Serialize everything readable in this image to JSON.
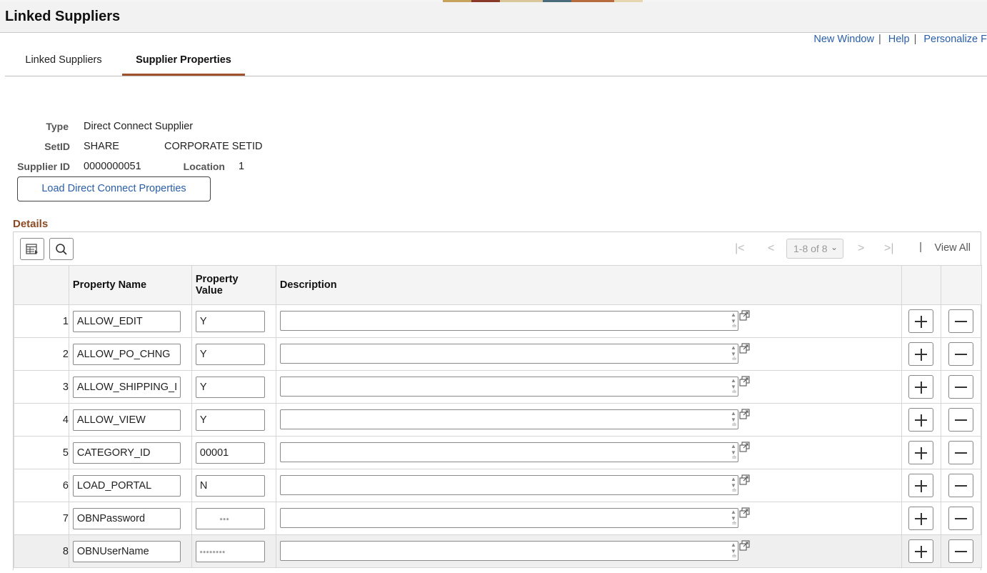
{
  "page": {
    "title": "Linked Suppliers"
  },
  "top_links": [
    {
      "label": "New Window"
    },
    {
      "label": "Help"
    },
    {
      "label": "Personalize F"
    }
  ],
  "tabs": [
    {
      "label": "Linked Suppliers",
      "active": false
    },
    {
      "label": "Supplier Properties",
      "active": true
    }
  ],
  "header": {
    "type_label": "Type",
    "type_value": "Direct Connect Supplier",
    "setid_label": "SetID",
    "setid_value": "SHARE",
    "setid_desc": "CORPORATE SETID",
    "supplier_id_label": "Supplier ID",
    "supplier_id_value": "0000000051",
    "location_label": "Location",
    "location_value": "1"
  },
  "load_button": {
    "label": "Load Direct Connect Properties"
  },
  "details": {
    "title": "Details",
    "pager": {
      "range": "1-8 of 8",
      "view_all": "View All"
    },
    "columns": {
      "name": "Property Name",
      "value_line1": "Property",
      "value_line2": "Value",
      "description": "Description"
    },
    "rows": [
      {
        "num": "1",
        "name": "ALLOW_EDIT",
        "value": "Y",
        "description": ""
      },
      {
        "num": "2",
        "name": "ALLOW_PO_CHNG",
        "value": "Y",
        "description": ""
      },
      {
        "num": "3",
        "name": "ALLOW_SHIPPING_I",
        "value": "Y",
        "description": ""
      },
      {
        "num": "4",
        "name": "ALLOW_VIEW",
        "value": "Y",
        "description": ""
      },
      {
        "num": "5",
        "name": "CATEGORY_ID",
        "value": "00001",
        "description": ""
      },
      {
        "num": "6",
        "name": "LOAD_PORTAL",
        "value": "N",
        "description": ""
      },
      {
        "num": "7",
        "name": "OBNPassword",
        "value": "",
        "description": ""
      },
      {
        "num": "8",
        "name": "OBNUserName",
        "value": "",
        "description": ""
      }
    ]
  },
  "icons": {
    "grid_personalize": "grid-personalize-icon",
    "search": "search-icon",
    "first": "first-page-icon",
    "prev": "previous-page-icon",
    "next": "next-page-icon",
    "last": "last-page-icon",
    "expand": "expand-popup-icon",
    "add": "plus-icon",
    "delete": "minus-icon"
  },
  "colors": {
    "link": "#2a5ea8",
    "tab_active_underline": "#a0522d",
    "section_title": "#8b4a22"
  }
}
